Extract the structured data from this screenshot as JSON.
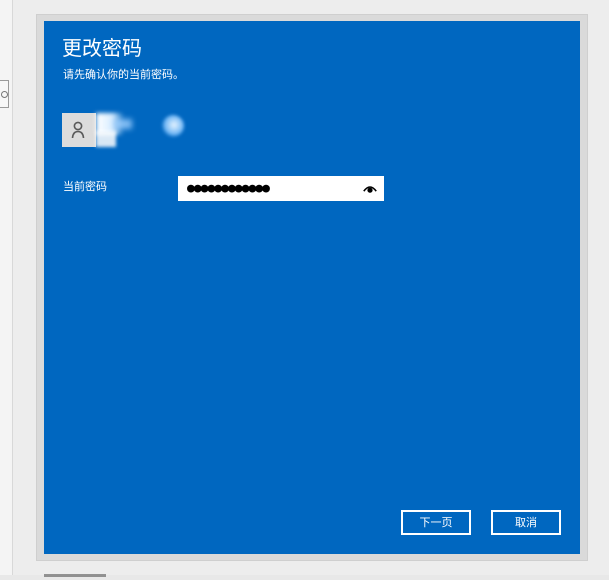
{
  "dialog": {
    "title": "更改密码",
    "subtitle": "请先确认你的当前密码。"
  },
  "account": {
    "avatar_icon": "user-avatar-icon"
  },
  "password": {
    "label": "当前密码",
    "value": "●●●●●●●●●●●●",
    "reveal_icon": "eye-icon"
  },
  "buttons": {
    "next_label": "下一页",
    "cancel_label": "取消"
  },
  "colors": {
    "dialog_background": "#0067c0",
    "text": "#ffffff",
    "field_background": "#ffffff"
  }
}
